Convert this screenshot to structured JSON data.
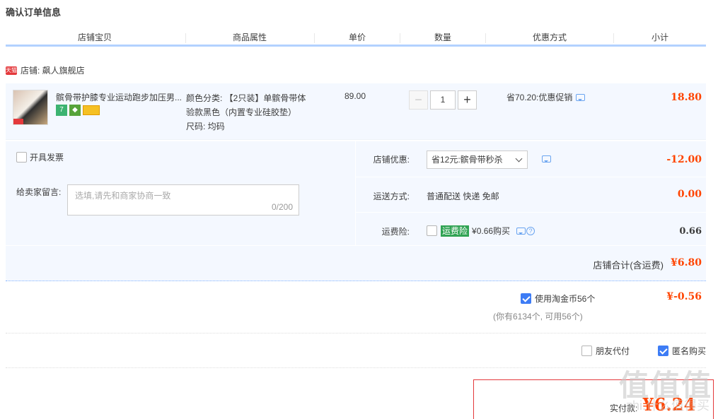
{
  "page_title": "确认订单信息",
  "columns": [
    "店铺宝贝",
    "商品属性",
    "单价",
    "数量",
    "优惠方式",
    "小计"
  ],
  "shop": {
    "badge": "天猫",
    "label": "店铺: 飙人旗舰店"
  },
  "item": {
    "title": "髌骨带护膝专业运动跑步加压男...",
    "svc_icons": [
      "seven-day-return-icon",
      "gold-badge-icon",
      "credit-card-icon"
    ],
    "attr_line1": "颜色分类: 【2只装】单髌骨带体",
    "attr_line2": "验款黑色（内置专业硅胶垫）",
    "attr_line3": "尺码: 均码",
    "price": "89.00",
    "qty": "1",
    "qty_minus": "−",
    "qty_plus": "+",
    "promo": "省70.20:优惠促销",
    "subtotal": "18.80"
  },
  "invoice_label": "开具发票",
  "message": {
    "label": "给卖家留言:",
    "placeholder": "选填,请先和商家协商一致",
    "count": "0/200"
  },
  "shop_discount": {
    "label": "店铺优惠:",
    "selected": "省12元:髌骨带秒杀",
    "amount": "-12.00"
  },
  "shipping": {
    "label": "运送方式:",
    "value": "普通配送 快递 免邮",
    "amount": "0.00"
  },
  "insurance": {
    "label": "运费险:",
    "tag": "运费险",
    "value": "¥0.66购买",
    "help": "?",
    "amount": "0.66"
  },
  "shop_total": {
    "label": "店铺合计(含运费)",
    "value": "¥6.80"
  },
  "coins": {
    "label": "使用淘金币56个",
    "sub": "(你有6134个, 可用56个)",
    "amount": "¥-0.56",
    "checked": true
  },
  "friend_pay": {
    "label": "朋友代付",
    "checked": false
  },
  "anonymous": {
    "label": "匿名购买",
    "checked": true
  },
  "payment": {
    "label": "实付款:",
    "value": "¥6.24"
  },
  "watermark": {
    "main": "值值值",
    "sub": "zhi.什么值得买"
  },
  "colors": {
    "accent": "#ff4400",
    "blue": "#3d7cf5",
    "panel": "#f4f8ff"
  }
}
